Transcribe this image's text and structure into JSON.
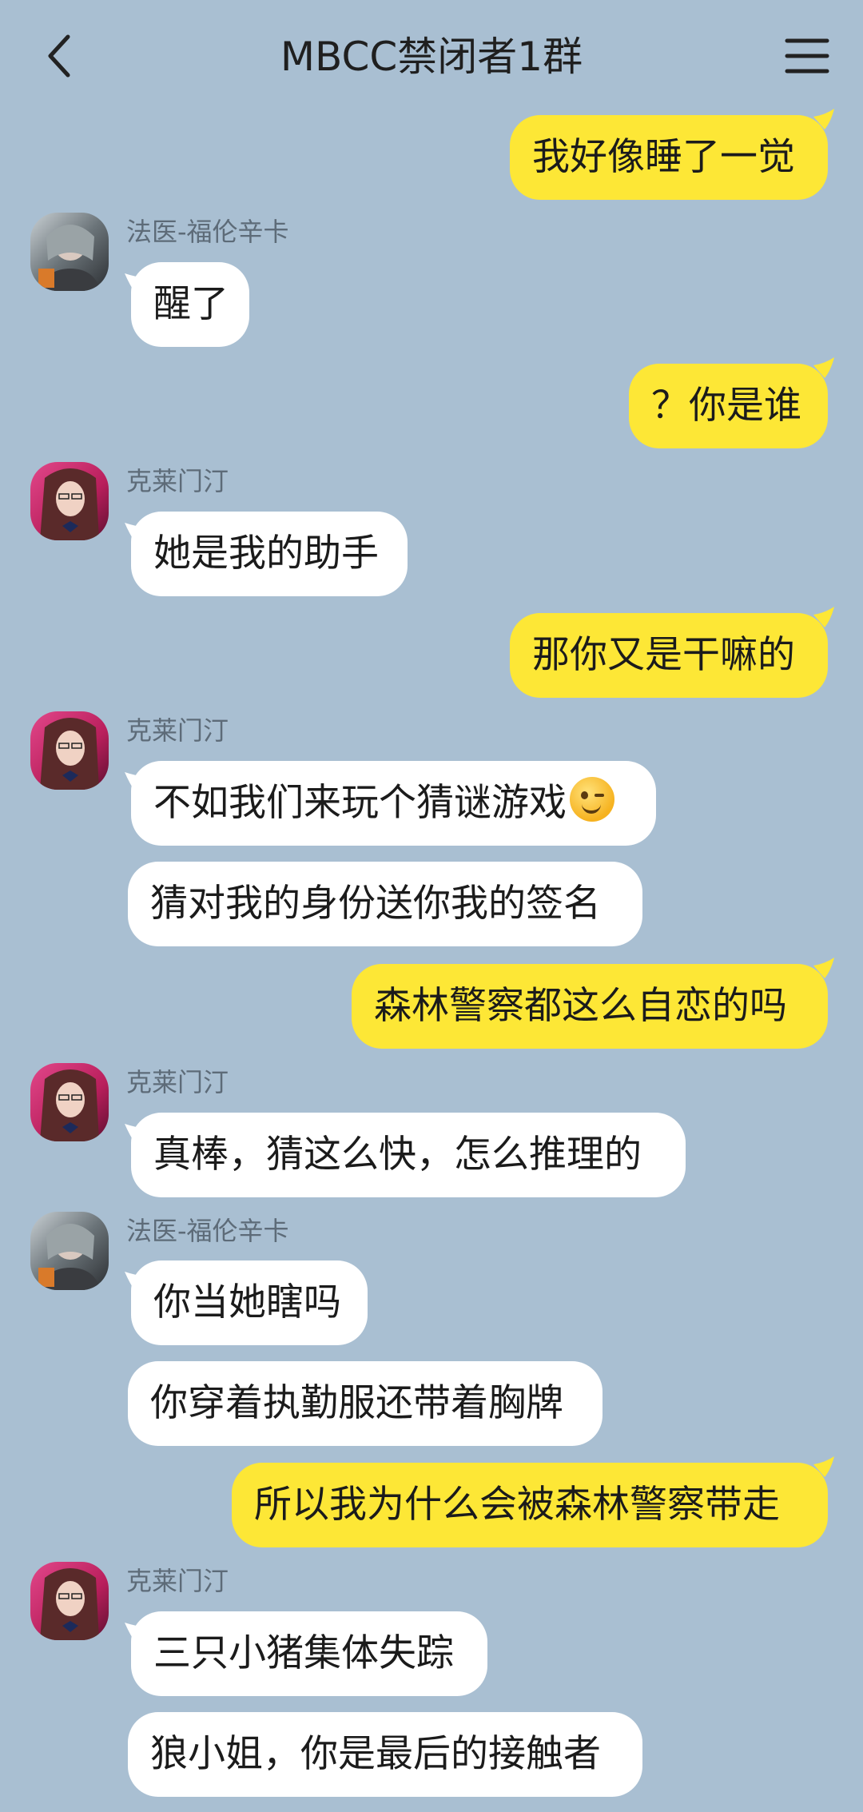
{
  "header": {
    "title": "MBCC禁闭者1群",
    "back_icon": "chevron-left-icon",
    "menu_icon": "hamburger-menu-icon"
  },
  "colors": {
    "background": "#a9bfd2",
    "mine_bubble": "#fde736",
    "their_bubble": "#ffffff"
  },
  "senders": {
    "forensic": "法医-福伦辛卡",
    "clementine": "克莱门汀"
  },
  "messages": {
    "m1": "我好像睡了一觉",
    "m2": "醒了",
    "m3": "？你是谁",
    "m4": "她是我的助手",
    "m5": "那你又是干嘛的",
    "m6": "不如我们来玩个猜谜游戏",
    "m7": "猜对我的身份送你我的签名",
    "m8": "森林警察都这么自恋的吗",
    "m9": "真棒，猜这么快，怎么推理的",
    "m10": "你当她瞎吗",
    "m11": "你穿着执勤服还带着胸牌",
    "m12": "所以我为什么会被森林警察带走",
    "m13": "三只小猪集体失踪",
    "m14": "狼小姐，你是最后的接触者"
  }
}
